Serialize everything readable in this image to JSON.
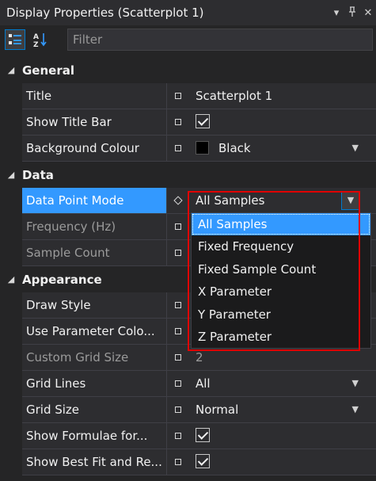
{
  "window": {
    "title": "Display Properties (Scatterplot 1)"
  },
  "toolbar": {
    "filter_placeholder": "Filter"
  },
  "sections": {
    "general": "General",
    "data": "Data",
    "appearance": "Appearance"
  },
  "general_rows": [
    {
      "name": "Title",
      "value": "Scatterplot 1"
    },
    {
      "name": "Show Title Bar",
      "checked": true
    },
    {
      "name": "Background Colour",
      "value": "Black",
      "swatch_color": "#000000"
    }
  ],
  "data_rows": [
    {
      "name": "Data Point Mode",
      "value": "All Samples"
    },
    {
      "name": "Frequency (Hz)",
      "value": ""
    },
    {
      "name": "Sample Count",
      "value": ""
    }
  ],
  "appearance_rows": [
    {
      "name": "Draw Style",
      "value": ""
    },
    {
      "name": "Use Parameter Colo...",
      "value": ""
    },
    {
      "name": "Custom Grid Size",
      "value": "2"
    },
    {
      "name": "Grid Lines",
      "value": "All"
    },
    {
      "name": "Grid Size",
      "value": "Normal"
    },
    {
      "name": "Show Formulae for...",
      "checked": true
    },
    {
      "name": "Show Best Fit and Re...",
      "checked": true
    }
  ],
  "dropdown": {
    "selected": "All Samples",
    "options": [
      "All Samples",
      "Fixed Frequency",
      "Fixed Sample Count",
      "X Parameter",
      "Y Parameter",
      "Z Parameter"
    ]
  },
  "colors": {
    "accent": "#3399ff",
    "highlight_box": "#e00000",
    "background": "#252526"
  }
}
